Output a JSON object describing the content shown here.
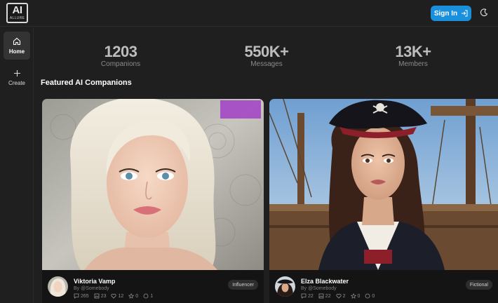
{
  "logo": {
    "mark": "AI",
    "word": "ALLURE"
  },
  "header": {
    "signin_label": "Sign In"
  },
  "sidebar": {
    "items": [
      {
        "label": "Home",
        "icon": "home-icon",
        "active": true
      },
      {
        "label": "Create",
        "icon": "plus-icon",
        "active": false
      }
    ]
  },
  "stats": [
    {
      "value": "1203",
      "label": "Companions"
    },
    {
      "value": "550K+",
      "label": "Messages"
    },
    {
      "value": "13K+",
      "label": "Members"
    }
  ],
  "section": {
    "title": "Featured AI Companions"
  },
  "cards": [
    {
      "name": "Viktoria Vamp",
      "by": "By @Somebody",
      "tag": "Influencer",
      "stats": {
        "chats": "265",
        "images": "23",
        "likes": "12",
        "stars": "0",
        "comments": "1"
      }
    },
    {
      "name": "Elza Blackwater",
      "by": "By @Somebody",
      "tag": "Fictional",
      "stats": {
        "chats": "22",
        "images": "22",
        "likes": "2",
        "stars": "0",
        "comments": "0"
      }
    }
  ],
  "colors": {
    "accent": "#1a8fdc",
    "background": "#1f1f1f",
    "card": "#141414"
  }
}
